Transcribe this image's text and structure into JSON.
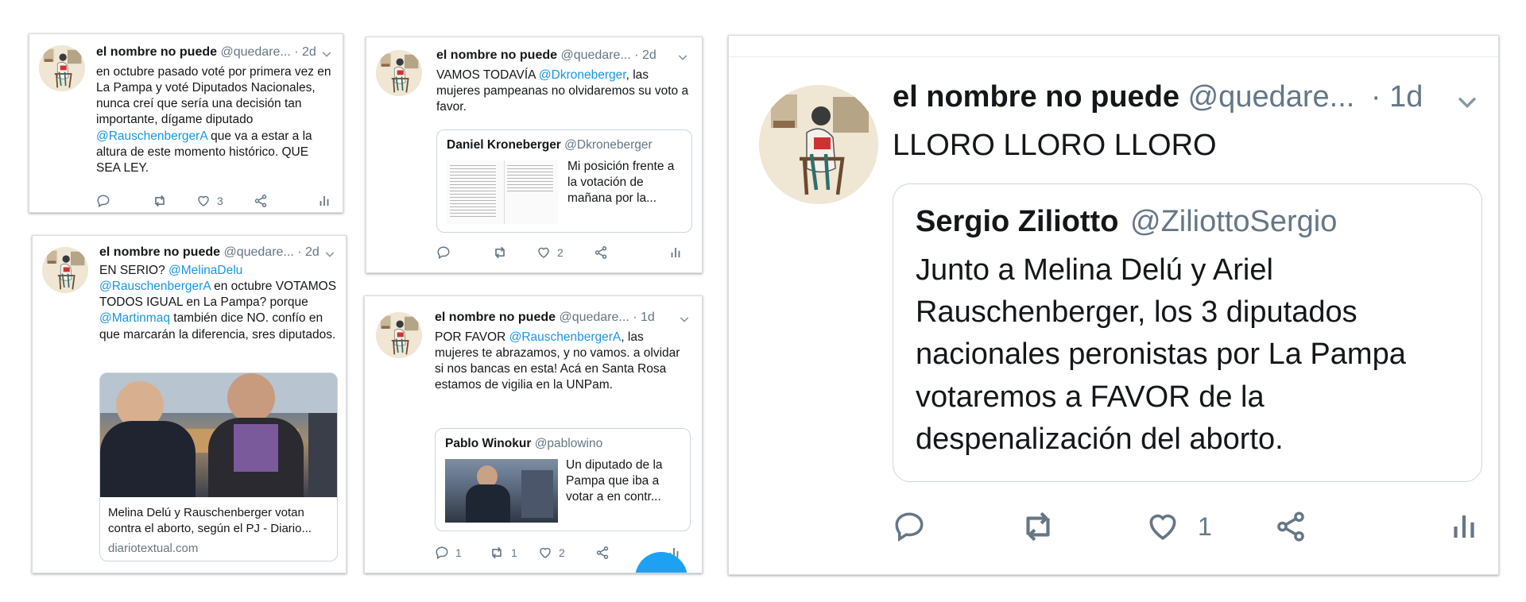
{
  "colors": {
    "mention": "#1b95e0",
    "text": "#14171a",
    "muted": "#657786",
    "border": "#ccd6dd",
    "fab": "#1da1f2"
  },
  "icons": [
    "reply-icon",
    "retweet-icon",
    "like-icon",
    "share-icon",
    "analytics-icon",
    "chevron-down-icon"
  ],
  "tweet1": {
    "author": "el nombre no puede",
    "handle": "@quedare...",
    "dot": "·",
    "time": "2d",
    "text": [
      "en octubre pasado voté por primera vez en La Pampa y voté Diputados Nacionales, nunca creí que sería una decisión tan importante, dígame diputado ",
      "@RauschenbergerA",
      " que va a estar a la altura de este momento histórico. QUE SEA LEY."
    ],
    "likes": "3"
  },
  "tweet2": {
    "author": "el nombre no puede",
    "handle": "@quedare...",
    "dot": "·",
    "time": "2d",
    "text": [
      "EN SERIO? ",
      "@MelinaDelu",
      " ",
      "@RauschenbergerA",
      " en octubre VOTAMOS TODOS IGUAL en La Pampa? porque ",
      "@Martinmaq",
      " también dice NO. confío en que marcarán la diferencia, sres diputados."
    ],
    "link_title": "Melina Delú y Rauschenberger votan contra el aborto, según el PJ - Diario...",
    "link_domain": "diariotextual.com"
  },
  "tweet3": {
    "author": "el nombre no puede",
    "handle": "@quedare...",
    "dot": "·",
    "time": "2d",
    "text": [
      "VAMOS TODAVÍA ",
      "@Dkroneberger",
      ", las mujeres pampeanas no olvidaremos su voto a favor."
    ],
    "quote_name": "Daniel Kroneberger",
    "quote_handle": "@Dkroneberger",
    "quote_text": "Mi posición frente a la votación de mañana por la...",
    "likes": "2"
  },
  "tweet4": {
    "author": "el nombre no puede",
    "handle": "@quedare...",
    "dot": "·",
    "time": "1d",
    "text": [
      "POR FAVOR ",
      "@RauschenbergerA",
      ", las mujeres te abrazamos, y no vamos. a olvidar si nos bancas en esta! Acá en Santa Rosa estamos de vigilia en la UNPam."
    ],
    "quote_name": "Pablo Winokur",
    "quote_handle": "@pablowino",
    "quote_text": "Un diputado de la Pampa que iba a votar a en contr...",
    "replies": "1",
    "retweets": "1",
    "likes": "2"
  },
  "tweet5": {
    "author": "el nombre no puede",
    "handle": "@quedare...",
    "dot": "·",
    "time": "1d",
    "text": "LLORO LLORO LLORO",
    "quote_name": "Sergio Ziliotto",
    "quote_handle": "@ZiliottoSergio",
    "quote_text": "Junto a Melina Delú y Ariel Rauschenberger, los 3 diputados nacionales peronistas por La Pampa votaremos a FAVOR de la despenalización del aborto.",
    "likes": "1"
  }
}
